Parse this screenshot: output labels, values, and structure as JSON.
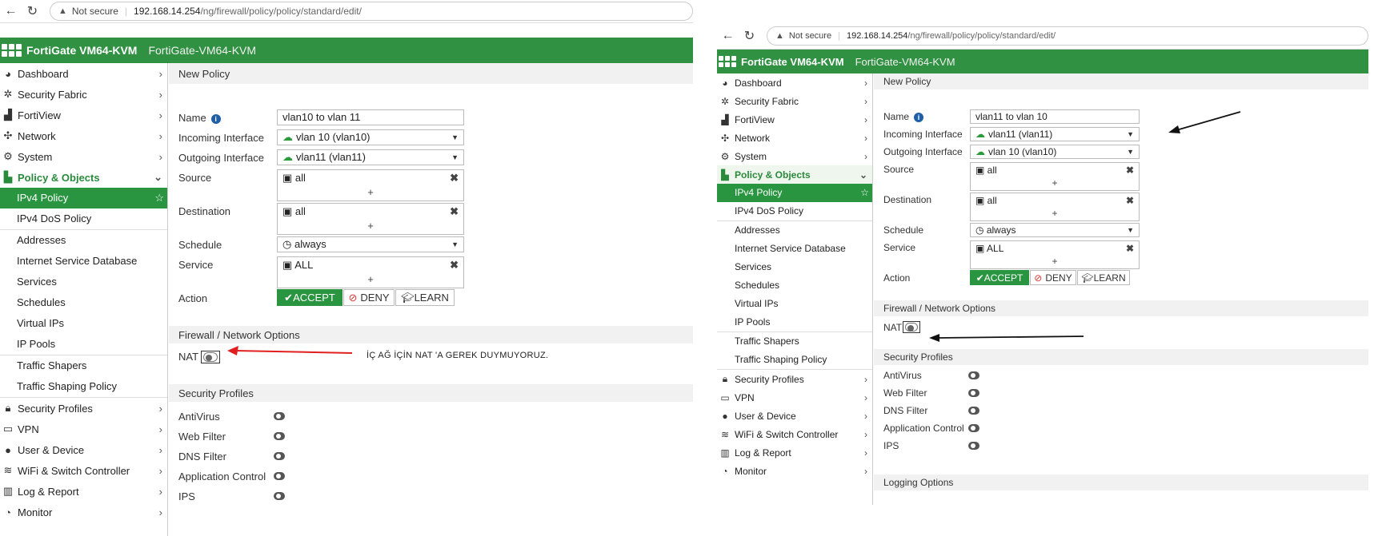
{
  "browser": {
    "not_secure": "Not secure",
    "host": "192.168.14.254",
    "path": "/ng/firewall/policy/policy/standard/edit/"
  },
  "header": {
    "brand": "FortiGate VM64-KVM",
    "hostname": "FortiGate-VM64-KVM",
    "accent": "#2f9141"
  },
  "sidebar": {
    "top_items": [
      {
        "label": "Dashboard",
        "icon": "dashboard-icon"
      },
      {
        "label": "Security Fabric",
        "icon": "fabric-icon"
      },
      {
        "label": "FortiView",
        "icon": "chart-icon"
      },
      {
        "label": "Network",
        "icon": "network-icon"
      },
      {
        "label": "System",
        "icon": "gear-icon"
      }
    ],
    "open_item": {
      "label": "Policy & Objects",
      "icon": "policy-icon"
    },
    "sub_items": [
      "IPv4 Policy",
      "IPv4 DoS Policy",
      "Addresses",
      "Internet Service Database",
      "Services",
      "Schedules",
      "Virtual IPs",
      "IP Pools",
      "Traffic Shapers",
      "Traffic Shaping Policy"
    ],
    "bottom_items": [
      {
        "label": "Security Profiles",
        "icon": "lock-icon"
      },
      {
        "label": "VPN",
        "icon": "laptop-icon"
      },
      {
        "label": "User & Device",
        "icon": "user-icon"
      },
      {
        "label": "WiFi & Switch Controller",
        "icon": "wifi-icon"
      },
      {
        "label": "Log & Report",
        "icon": "report-icon"
      },
      {
        "label": "Monitor",
        "icon": "monitor-icon"
      }
    ]
  },
  "form_labels": {
    "title": "New Policy",
    "name": "Name",
    "incoming": "Incoming Interface",
    "outgoing": "Outgoing Interface",
    "source": "Source",
    "destination": "Destination",
    "schedule": "Schedule",
    "service": "Service",
    "action": "Action",
    "firewall_options": "Firewall / Network Options",
    "nat": "NAT",
    "security_profiles": "Security Profiles",
    "antivirus": "AntiVirus",
    "web_filter": "Web Filter",
    "dns_filter": "DNS Filter",
    "app_control": "Application Control",
    "ips": "IPS",
    "logging_options": "Logging Options",
    "accept": "ACCEPT",
    "deny": "DENY",
    "learn": "LEARN",
    "plus": "+"
  },
  "left": {
    "name_value": "vlan10 to vlan 11",
    "incoming_value": "vlan 10 (vlan10)",
    "outgoing_value": "vlan11 (vlan11)",
    "source_value": "all",
    "destination_value": "all",
    "schedule_value": "always",
    "service_value": "ALL",
    "annotation": "İÇ AĞ İÇİN NAT 'A  GEREK DUYMUYORUZ."
  },
  "right": {
    "name_value": "vlan11 to vlan 10",
    "incoming_value": "vlan11 (vlan11)",
    "outgoing_value": "vlan 10 (vlan10)",
    "source_value": "all",
    "destination_value": "all",
    "schedule_value": "always",
    "service_value": "ALL"
  }
}
